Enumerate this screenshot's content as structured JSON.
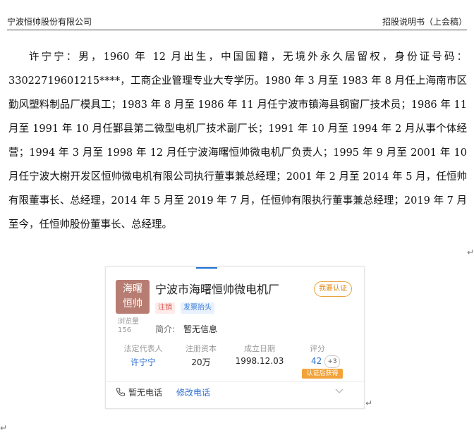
{
  "header": {
    "company": "宁波恒帅股份有限公司",
    "doc_title": "招股说明书（上会稿）"
  },
  "paragraph": "许宁宁：男，1960 年 12 月出生，中国国籍，无境外永久居留权，身份证号码：33022719601215****，工商企业管理专业大专学历。1980 年 3 月至 1983 年 8 月任上海南市区勤风塑料制品厂模具工；1983 年 8 月至 1986 年 11 月任宁波市镇海县钢窗厂技术员；1986 年 11 月至 1991 年 10 月任鄞县第二微型电机厂技术副厂长；1991 年 10 月至 1994 年 2 月从事个体经营；1994 年 3 月至 1998 年 12 月任宁波海曙恒帅微电机厂负责人；1995 年 9 月至 2001 年 10 月任宁波大榭开发区恒帅微电机有限公司执行董事兼总经理；2001 年 2 月至 2014 年 5 月，任恒帅有限董事长、总经理，2014 年 5 月至 2019 年 7 月，任恒帅有限执行董事兼总经理；2019 年 7 月至今，任恒帅股份董事长、总经理。",
  "return_mark": "↵",
  "card": {
    "logo_line1": "海曙",
    "logo_line2": "恒帅",
    "views_label": "浏览量",
    "views_value": "156",
    "company_name": "宁波市海曙恒帅微电机厂",
    "verify_button": "我要认证",
    "tags": [
      "注销",
      "发票抬头"
    ],
    "intro_label": "简介:",
    "intro_value": "暂无信息",
    "fields": [
      {
        "label": "法定代表人",
        "value": "许宁宁"
      },
      {
        "label": "注册资本",
        "value": "20万"
      },
      {
        "label": "成立日期",
        "value": "1998.12.03"
      },
      {
        "label": "评分",
        "value": "42"
      }
    ],
    "score_plus": "+3",
    "score_badge": "认证后获得",
    "phone_text": "暂无电话",
    "edit_phone": "修改电话",
    "icons": [
      "phone-icon",
      "chevron-down-icon"
    ],
    "accent_color": "#2f6fd0",
    "logo_color": "#b77d72"
  }
}
